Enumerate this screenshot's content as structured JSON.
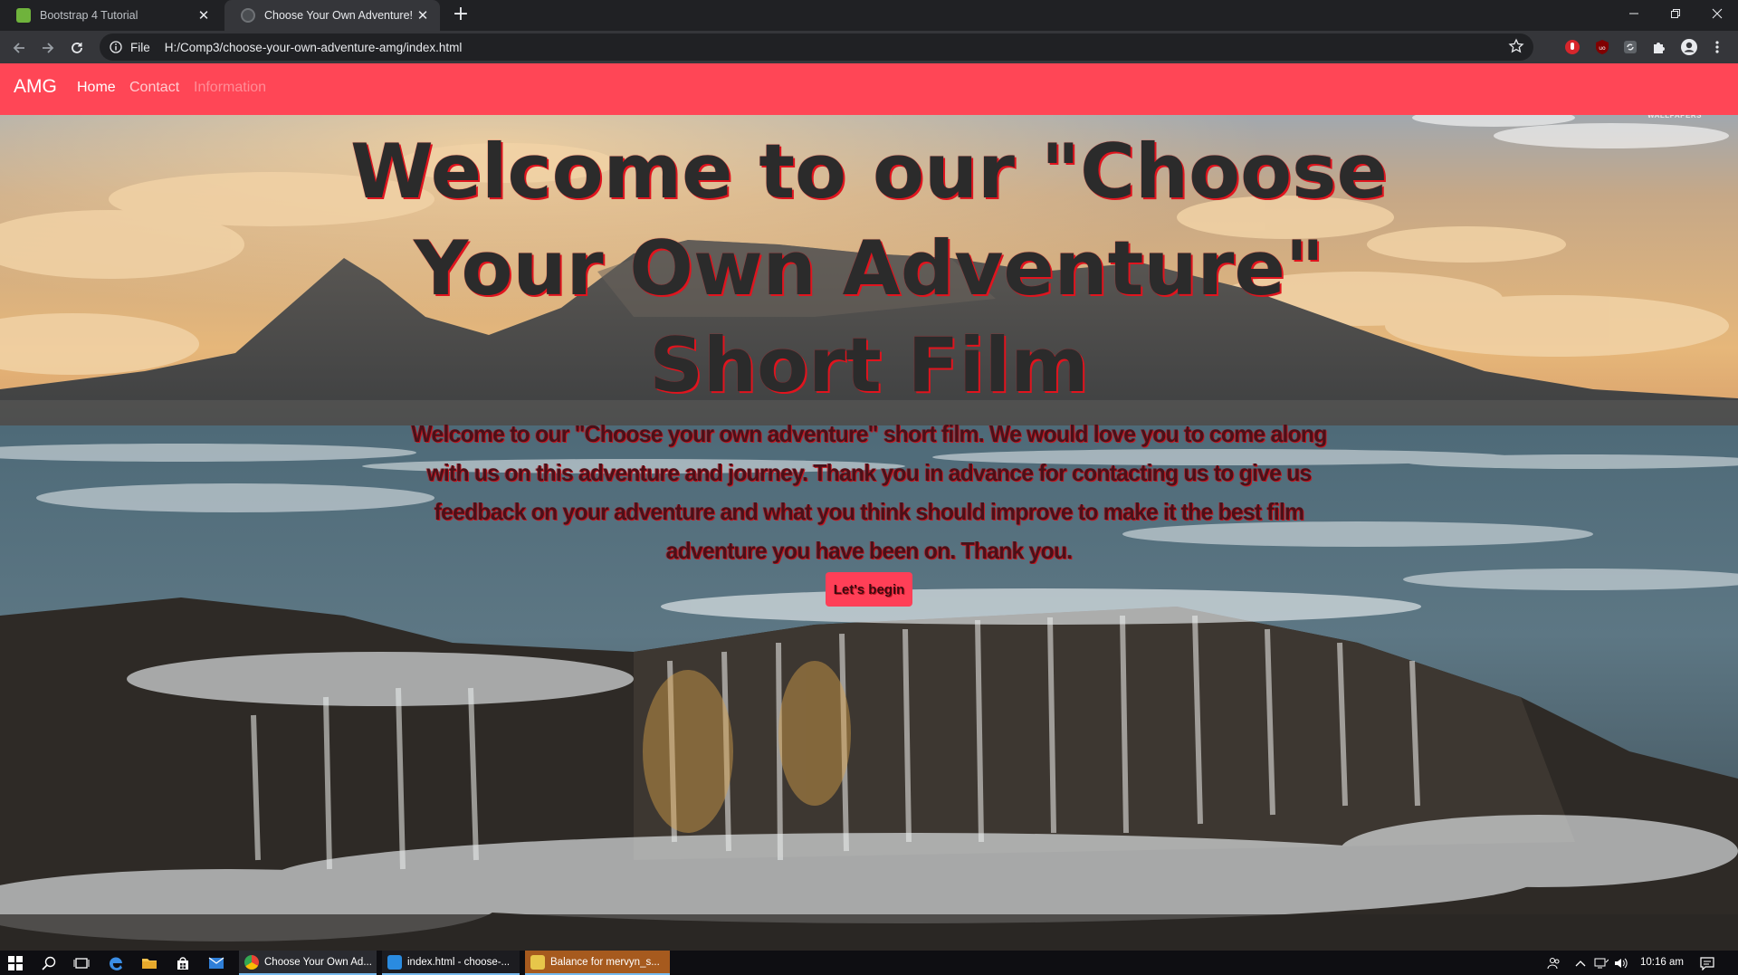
{
  "browser": {
    "tabs": [
      {
        "title": "Bootstrap 4 Tutorial",
        "active": false
      },
      {
        "title": "Choose Your Own Adventure! | H",
        "active": true
      }
    ],
    "omnibox": {
      "scheme_label": "File",
      "url": "H:/Comp3/choose-your-own-adventure-amg/index.html"
    }
  },
  "site": {
    "brand": "AMG",
    "nav": {
      "home": "Home",
      "contact": "Contact",
      "information": "Information"
    },
    "watermark": "WALLPAPERS",
    "hero": {
      "title": "Welcome to our \"Choose Your Own Adventure\" Short Film",
      "text": "Welcome to our \"Choose your own adventure\" short film. We would love you to come along with us on this adventure and journey. Thank you in advance for contacting us to give us feedback on your adventure and what you think should improve to make it the best film adventure you have been on. Thank you.",
      "button": "Let's begin"
    },
    "colors": {
      "navbar": "#ff4656",
      "button": "#ff3f57",
      "title_shadow": "#e0141e"
    }
  },
  "taskbar": {
    "apps": [
      {
        "label": "Choose Your Own Ad..."
      },
      {
        "label": "index.html - choose-..."
      },
      {
        "label": "Balance for mervyn_s..."
      }
    ],
    "clock": "10:16 am"
  }
}
